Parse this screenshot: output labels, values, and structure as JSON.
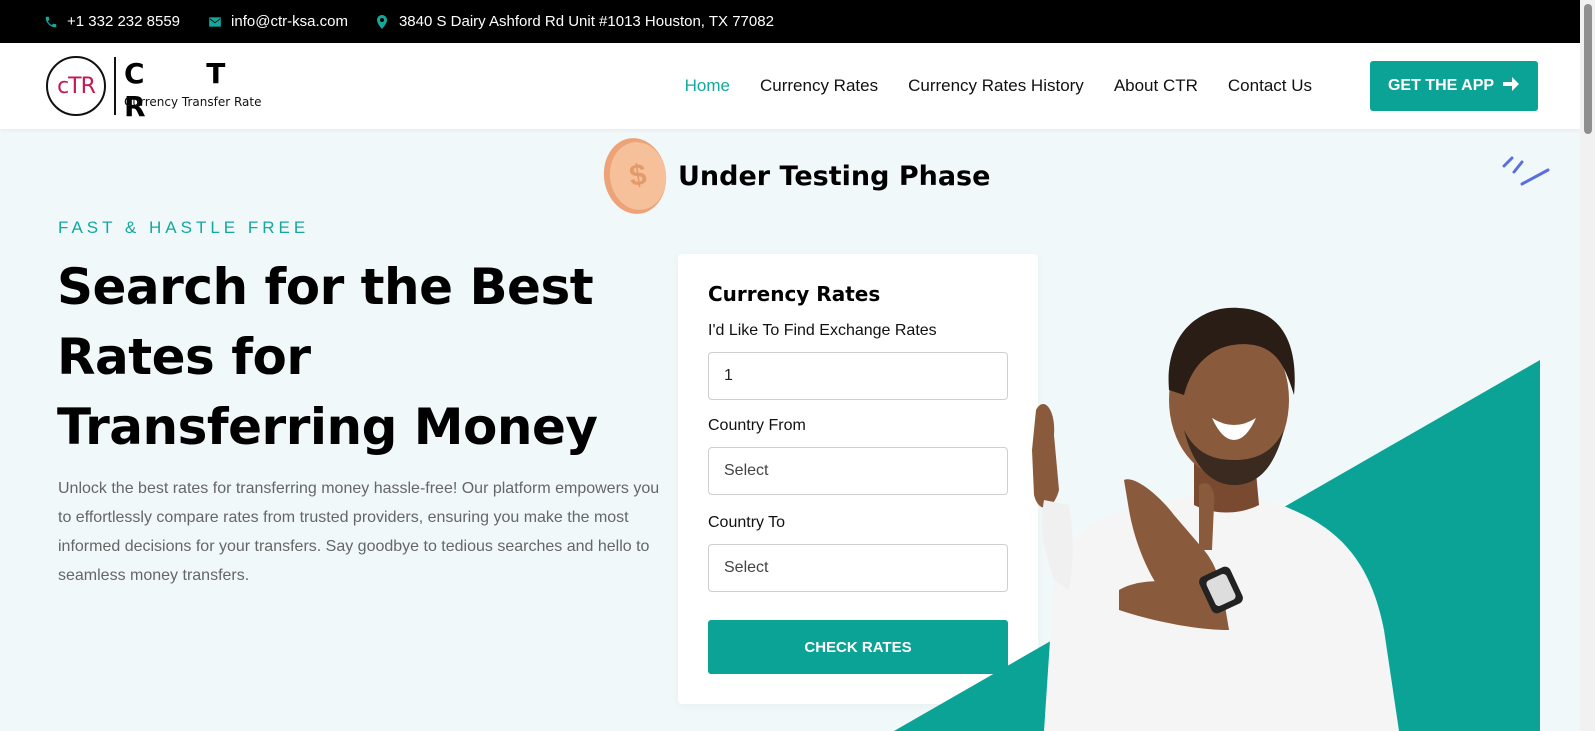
{
  "topbar": {
    "phone": "+1 332 232 8559",
    "email": "info@ctr-ksa.com",
    "address": "3840 S Dairy Ashford Rd Unit #1013 Houston, TX 77082"
  },
  "logo": {
    "mark": "cTR",
    "name": "C T R",
    "tagline": "Currency Transfer Rate"
  },
  "nav": {
    "items": [
      {
        "label": "Home",
        "active": true
      },
      {
        "label": "Currency Rates"
      },
      {
        "label": "Currency Rates History"
      },
      {
        "label": "About CTR"
      },
      {
        "label": "Contact Us"
      }
    ],
    "cta_label": "GET THE APP"
  },
  "hero": {
    "testing_label": "Under Testing Phase",
    "eyebrow": "FAST & HASTLE FREE",
    "headline": "Search for the Best Rates for Transferring Money",
    "description": "Unlock the best rates for transferring money hassle-free! Our platform empowers you to effortlessly compare rates from trusted providers, ensuring you make the most informed decisions for your transfers. Say goodbye to tedious searches and hello to seamless money transfers."
  },
  "form": {
    "title": "Currency Rates",
    "amount_label": "I'd Like To Find Exchange Rates",
    "amount_value": "1",
    "from_label": "Country From",
    "from_value": "Select",
    "to_label": "Country To",
    "to_value": "Select",
    "submit_label": "CHECK RATES"
  },
  "colors": {
    "accent": "#0aa395",
    "topbar_bg": "#000000",
    "hero_bg": "#f1f8fa",
    "brand_red": "#c8184f"
  }
}
